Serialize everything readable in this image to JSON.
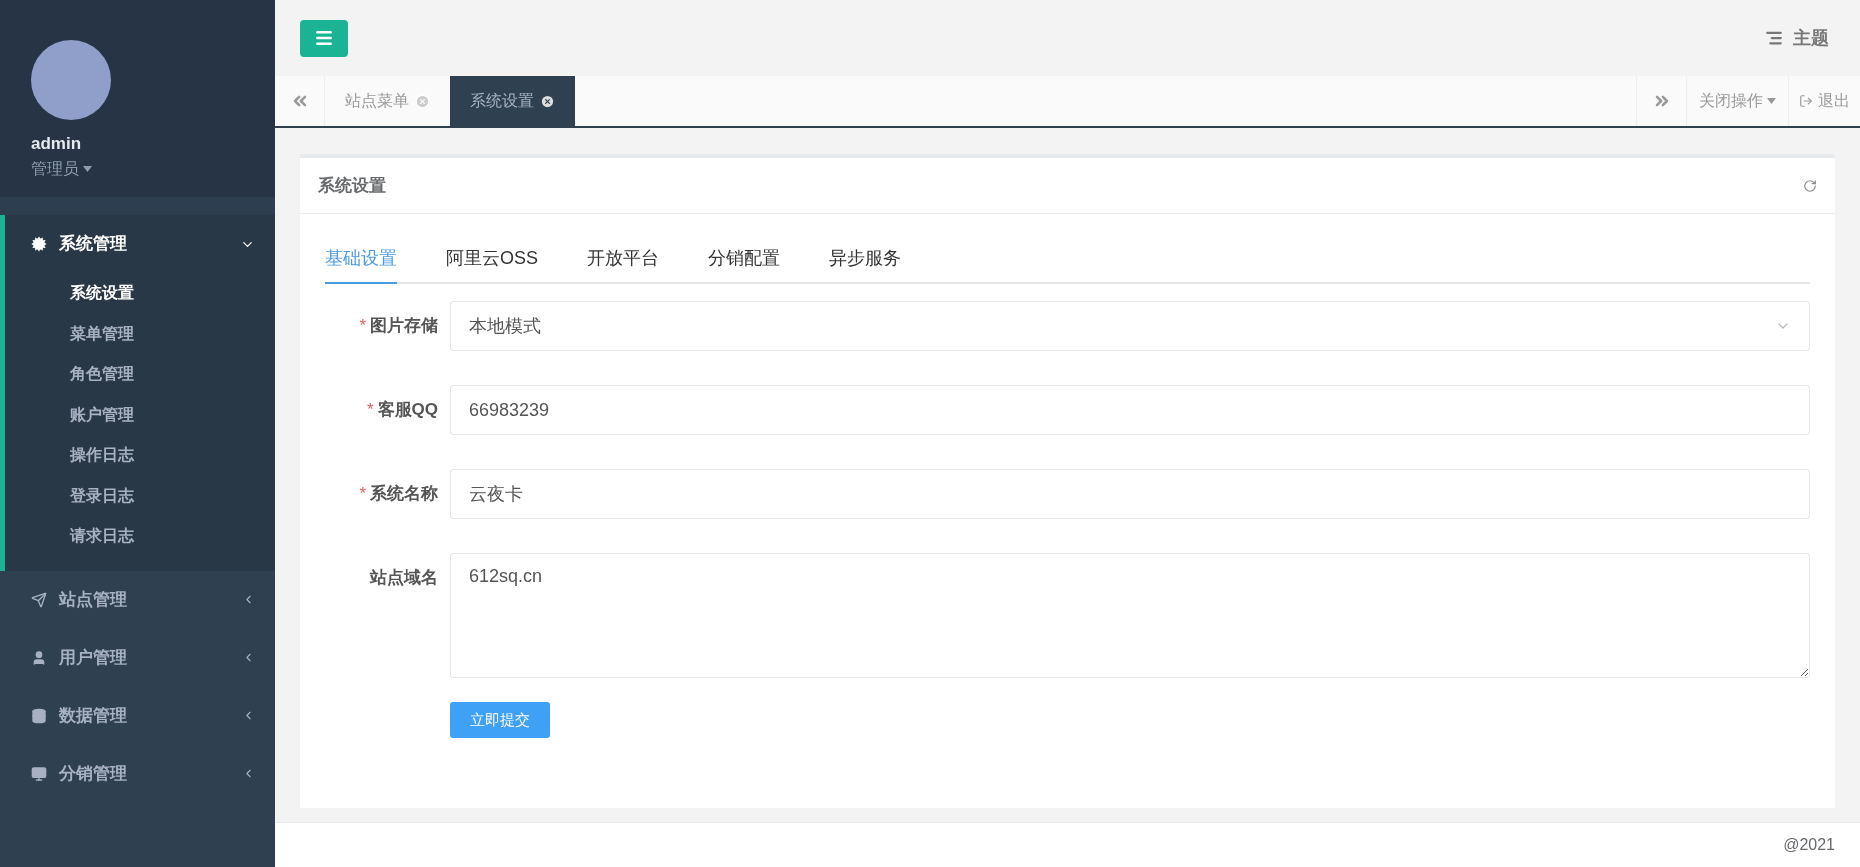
{
  "header": {
    "theme_label": "主题"
  },
  "user": {
    "name": "admin",
    "role": "管理员"
  },
  "menu": [
    {
      "label": "系统管理",
      "expanded": true,
      "children": [
        {
          "label": "系统设置",
          "selected": true
        },
        {
          "label": "菜单管理",
          "selected": false
        },
        {
          "label": "角色管理",
          "selected": false
        },
        {
          "label": "账户管理",
          "selected": false
        },
        {
          "label": "操作日志",
          "selected": false
        },
        {
          "label": "登录日志",
          "selected": false
        },
        {
          "label": "请求日志",
          "selected": false
        }
      ]
    },
    {
      "label": "站点管理",
      "expanded": false
    },
    {
      "label": "用户管理",
      "expanded": false
    },
    {
      "label": "数据管理",
      "expanded": false
    },
    {
      "label": "分销管理",
      "expanded": false
    }
  ],
  "page_tabs": [
    {
      "label": "站点菜单",
      "selected": false
    },
    {
      "label": "系统设置",
      "selected": true
    }
  ],
  "tab_actions": {
    "close_menu": "关闭操作",
    "logout": "退出"
  },
  "panel": {
    "title": "系统设置",
    "tabs": [
      {
        "label": "基础设置",
        "selected": true
      },
      {
        "label": "阿里云OSS",
        "selected": false
      },
      {
        "label": "开放平台",
        "selected": false
      },
      {
        "label": "分销配置",
        "selected": false
      },
      {
        "label": "异步服务",
        "selected": false
      }
    ],
    "fields": [
      {
        "label": "图片存储",
        "required_mark": "*",
        "kind": "select",
        "value": "本地模式"
      },
      {
        "label": "客服QQ",
        "required_mark": "*",
        "kind": "text",
        "value": "66983239"
      },
      {
        "label": "系统名称",
        "required_mark": "*",
        "kind": "text",
        "value": "云夜卡"
      },
      {
        "label": "站点域名",
        "kind": "textarea",
        "value": "612sq.cn"
      }
    ],
    "submit": "立即提交"
  },
  "footer": "@2021"
}
